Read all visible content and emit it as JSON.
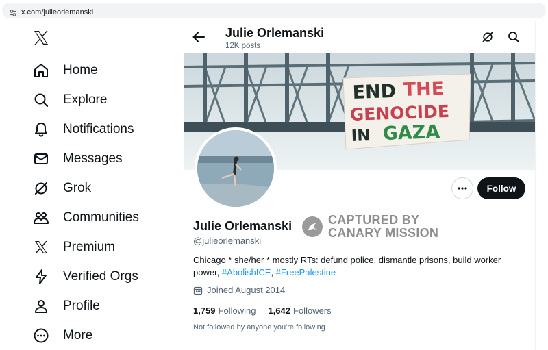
{
  "browser": {
    "url": "x.com/julieorlemanski"
  },
  "sidebar": {
    "items": [
      {
        "label": "Home",
        "icon": "home-icon"
      },
      {
        "label": "Explore",
        "icon": "search-icon"
      },
      {
        "label": "Notifications",
        "icon": "bell-icon"
      },
      {
        "label": "Messages",
        "icon": "mail-icon"
      },
      {
        "label": "Grok",
        "icon": "grok-icon"
      },
      {
        "label": "Communities",
        "icon": "people-icon"
      },
      {
        "label": "Premium",
        "icon": "x-icon"
      },
      {
        "label": "Verified Orgs",
        "icon": "bolt-icon"
      },
      {
        "label": "Profile",
        "icon": "person-icon"
      },
      {
        "label": "More",
        "icon": "more-circle-icon"
      }
    ]
  },
  "header": {
    "name": "Julie Orlemanski",
    "posts": "12K posts"
  },
  "banner": {
    "sign_lines": [
      "END THE",
      "GENOCIDE",
      "IN GAZA"
    ]
  },
  "profile": {
    "display_name": "Julie Orlemanski",
    "handle": "@julieorlemanski",
    "bio_text": "Chicago * she/her * mostly RTs: defund police, dismantle prisons, build worker power, ",
    "bio_tag1": "#AbolishICE",
    "bio_sep": ", ",
    "bio_tag2": "#FreePalestine",
    "joined": "Joined August 2014",
    "following_count": "1,759",
    "following_label": "Following",
    "followers_count": "1,642",
    "followers_label": "Followers",
    "not_followed": "Not followed by anyone you're following",
    "follow_label": "Follow"
  },
  "watermark": {
    "line1": "CAPTURED BY",
    "line2": "CANARY MISSION"
  },
  "colors": {
    "accent": "#1d9bf0",
    "text": "#0f1419",
    "muted": "#536471",
    "button": "#0f1419"
  }
}
